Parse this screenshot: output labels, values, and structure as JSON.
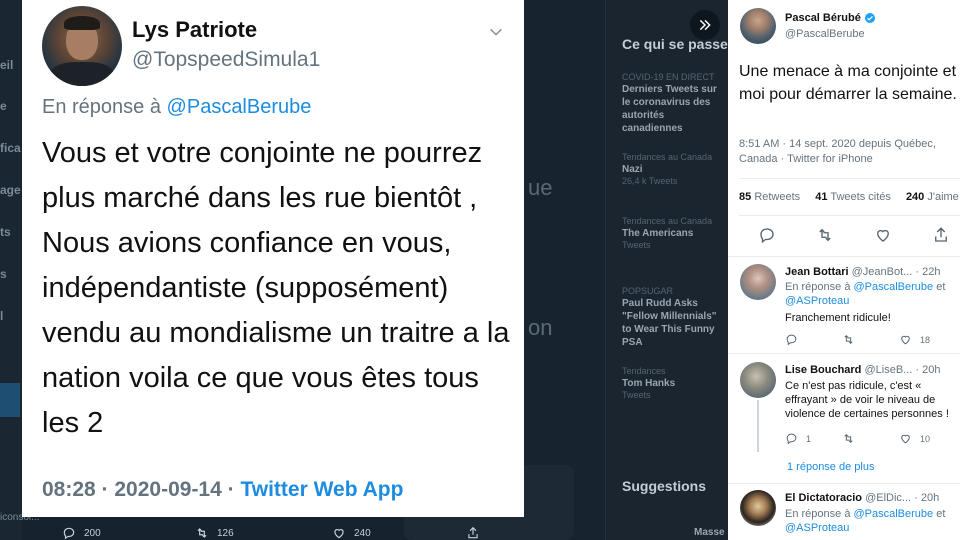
{
  "background": {
    "nav_fragments": [
      "eil",
      "e",
      "fica",
      "age",
      "ts",
      "s",
      "l"
    ],
    "mid_fragments": [
      "ue",
      "on"
    ],
    "trends_title": "Ce qui se passe",
    "trends": [
      {
        "small": "COVID-19 EN DIRECT",
        "big": "Derniers Tweets sur le coronavirus des autorités canadiennes"
      },
      {
        "small": "Tendances au Canada",
        "big": "Nazi",
        "count": "26,4 k Tweets"
      },
      {
        "small": "Tendances au Canada",
        "big": "The Americans",
        "count": "Tweets"
      },
      {
        "small": "POPSUGAR",
        "big": "Paul Rudd Asks \"Fellow Millennials\" to Wear This Funny PSA"
      },
      {
        "small": "Tendances",
        "big": "Tom Hanks",
        "count": "Tweets"
      }
    ],
    "suggestions_title": "Suggestions",
    "suggestion_fragment": "Masse",
    "bottom_counts": {
      "replies": "200",
      "retweets": "126",
      "likes": "240"
    },
    "left_bottom_fragment": "iconsol..."
  },
  "quoted_tweet": {
    "name": "Lys Patriote",
    "handle": "@TopspeedSimula1",
    "reply_prefix": "En réponse à",
    "reply_to": "@PascalBerube",
    "text": "Vous et votre conjointe ne pourrez plus marché dans les rue bientôt , Nous avions confiance en vous, indépendantiste (supposément) vendu au mondialisme un traitre a la nation voila ce que vous êtes tous les 2",
    "time": "08:28 · 2020-09-14 ·",
    "source": "Twitter Web App"
  },
  "main_tweet": {
    "name": "Pascal Bérubé",
    "handle": "@PascalBerube",
    "text": "Une menace à ma conjointe et moi pour démarrer la semaine.",
    "meta": "8:51 AM · 14 sept. 2020 depuis Québec, Canada · Twitter for iPhone",
    "retweets_count": "85",
    "retweets_label": "Retweets",
    "quotes_count": "41",
    "quotes_label": "Tweets cités",
    "likes_count": "240",
    "likes_label": "J'aime"
  },
  "replies": [
    {
      "name": "Jean Bottari",
      "handle": "@JeanBot...",
      "time": "· 22h",
      "reply_prefix": "En réponse à",
      "reply_to": "@PascalBerube",
      "conj": "et",
      "reply_to2": "@ASProteau",
      "text": "Franchement ridicule!",
      "replies": "",
      "retweets": "",
      "likes": "18"
    },
    {
      "name": "Lise Bouchard",
      "handle": "@LiseB...",
      "time": "· 20h",
      "text": "Ce n'est pas ridicule, c'est « effrayant » de voir le niveau de violence de certaines personnes !",
      "replies": "1",
      "retweets": "",
      "likes": "10"
    },
    {
      "name": "El Dictatoracio",
      "handle": "@ElDic...",
      "time": "· 20h",
      "reply_prefix": "En réponse à",
      "reply_to": "@PascalBerube",
      "conj": "et",
      "reply_to2": "@ASProteau"
    }
  ],
  "more_replies": "1 réponse de plus",
  "colors": {
    "link": "#1c8ce0",
    "muted": "#65737f",
    "dark_bg": "#15202b"
  }
}
